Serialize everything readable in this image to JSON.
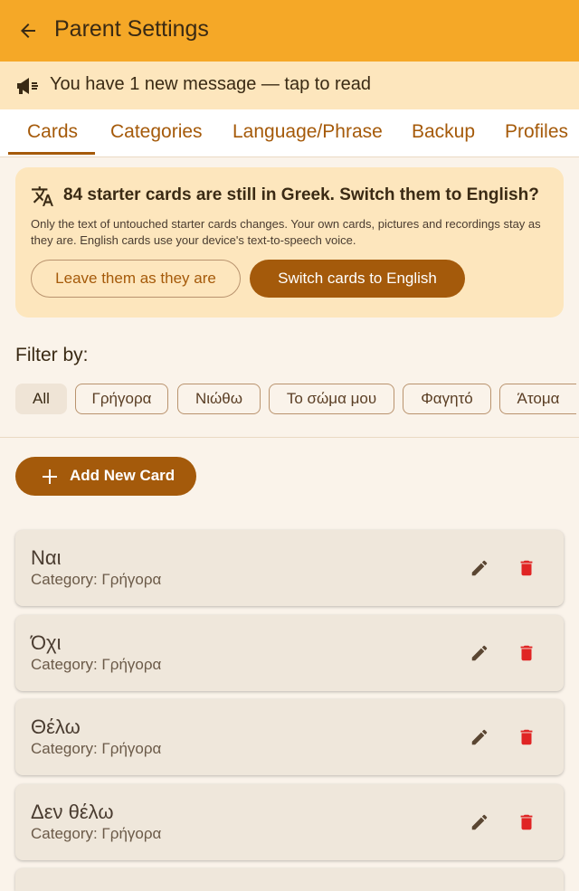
{
  "appbar": {
    "title": "Parent Settings"
  },
  "banner": {
    "text": "You have 1 new message — tap to read"
  },
  "tabs": [
    {
      "label": "Cards"
    },
    {
      "label": "Categories"
    },
    {
      "label": "Language/Phrase"
    },
    {
      "label": "Backup"
    },
    {
      "label": "Profiles"
    }
  ],
  "notice": {
    "title": "84 starter cards are still in Greek. Switch them to English?",
    "body": "Only the text of untouched starter cards changes. Your own cards, pictures and recordings stay as they are. English cards use your device's text-to-speech voice.",
    "leave_label": "Leave them as they are",
    "switch_label": "Switch cards to English"
  },
  "filter": {
    "label": "Filter by:",
    "chips": [
      "All",
      "Γρήγορα",
      "Νιώθω",
      "Το σώμα μου",
      "Φαγητό",
      "Άτομα"
    ],
    "selected": "All"
  },
  "add_button": {
    "label": "Add New Card"
  },
  "cards": [
    {
      "name": "Ναι",
      "category": "Category: Γρήγορα"
    },
    {
      "name": "Όχι",
      "category": "Category: Γρήγορα"
    },
    {
      "name": "Θέλω",
      "category": "Category: Γρήγορα"
    },
    {
      "name": "Δεν θέλω",
      "category": "Category: Γρήγορα"
    }
  ],
  "colors": {
    "appbar": "#f5a827",
    "accent": "#a45a0b",
    "delete": "#e02424",
    "edit": "#5a4632"
  },
  "icons": {
    "back": "arrow-back-icon",
    "banner": "megaphone-icon",
    "notice": "translate-icon",
    "add": "plus-icon",
    "edit": "pencil-icon",
    "delete": "trash-icon"
  }
}
